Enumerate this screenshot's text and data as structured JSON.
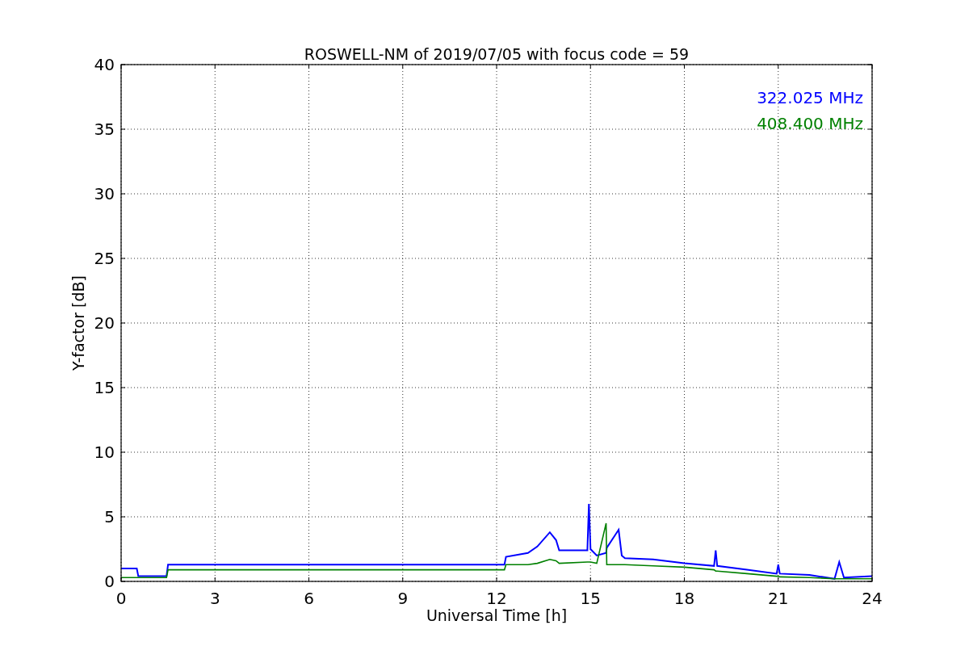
{
  "chart_data": {
    "type": "line",
    "title": "ROSWELL-NM of 2019/07/05 with focus code = 59",
    "xlabel": "Universal Time [h]",
    "ylabel": "Y-factor [dB]",
    "x": [
      0,
      0.5,
      0.55,
      1.45,
      1.5,
      12.25,
      12.3,
      13,
      13.3,
      13.7,
      13.9,
      14.0,
      14.9,
      14.95,
      15.0,
      15.2,
      15.5,
      15.52,
      15.9,
      16.0,
      16.1,
      17,
      18,
      18.95,
      19.0,
      19.05,
      20,
      20.95,
      21.0,
      21.05,
      22,
      22.8,
      22.95,
      23.1,
      24
    ],
    "series": [
      {
        "name": "322.025 MHz",
        "color": "#0000ff",
        "values": [
          1.0,
          1.0,
          0.4,
          0.4,
          1.3,
          1.3,
          1.9,
          2.2,
          2.7,
          3.8,
          3.2,
          2.4,
          2.4,
          6.0,
          2.5,
          2.0,
          2.2,
          2.6,
          4.0,
          2.0,
          1.8,
          1.7,
          1.4,
          1.2,
          2.4,
          1.2,
          0.9,
          0.6,
          1.3,
          0.6,
          0.5,
          0.2,
          1.5,
          0.3,
          0.4
        ]
      },
      {
        "name": "408.400 MHz",
        "color": "#008000",
        "values": [
          0.3,
          0.3,
          0.3,
          0.3,
          0.9,
          0.9,
          1.3,
          1.3,
          1.4,
          1.7,
          1.6,
          1.4,
          1.5,
          1.5,
          1.5,
          1.4,
          4.5,
          1.3,
          1.3,
          1.3,
          1.3,
          1.2,
          1.1,
          0.9,
          0.8,
          0.8,
          0.6,
          0.4,
          0.4,
          0.35,
          0.3,
          0.2,
          0.2,
          0.2,
          0.2
        ]
      }
    ],
    "xlim": [
      0,
      24
    ],
    "ylim": [
      0,
      40
    ],
    "xticks": [
      0,
      3,
      6,
      9,
      12,
      15,
      18,
      21,
      24
    ],
    "yticks": [
      0,
      5,
      10,
      15,
      20,
      25,
      30,
      35,
      40
    ],
    "grid": true
  }
}
